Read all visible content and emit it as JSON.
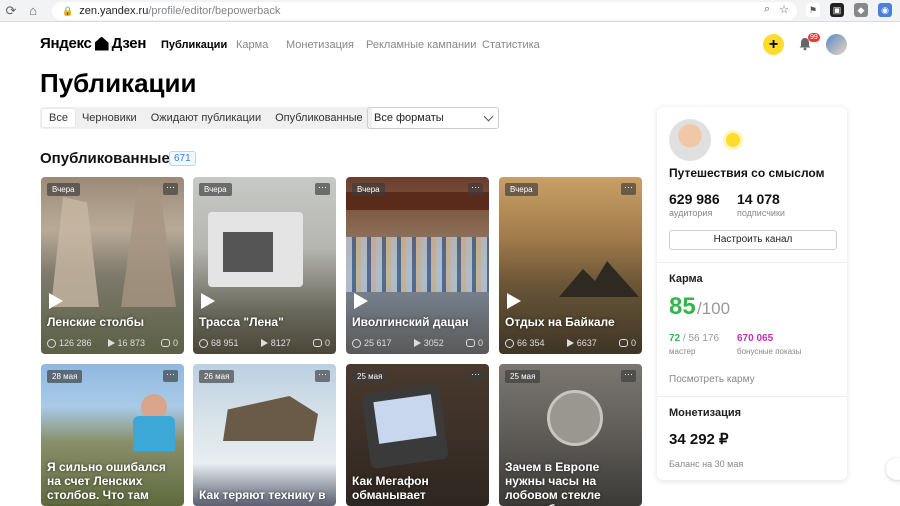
{
  "browser": {
    "url_host": "zen.yandex.ru",
    "url_path": "/profile/editor/bepowerback"
  },
  "nav": {
    "logo": "Яндекс",
    "logo_product": "Дзен",
    "items": [
      {
        "label": "Публикации",
        "active": true
      },
      {
        "label": "Карма",
        "active": false
      },
      {
        "label": "Монетизация",
        "active": false
      },
      {
        "label": "Рекламные кампании",
        "active": false
      },
      {
        "label": "Статистика",
        "active": false
      }
    ],
    "plus": "+",
    "notifications_count": "99"
  },
  "page": {
    "title": "Публикации"
  },
  "filters": {
    "tabs": [
      "Все",
      "Черновики",
      "Ожидают публикации",
      "Опубликованные"
    ],
    "active_tab": "Все",
    "format_select": "Все форматы"
  },
  "section": {
    "title": "Опубликованные",
    "count": "671"
  },
  "cards": [
    {
      "badge": "Вчера",
      "title": "Ленские столбы",
      "views": "126 286",
      "plays": "16 873",
      "comments": "0"
    },
    {
      "badge": "Вчера",
      "title": "Трасса \"Лена\"",
      "views": "68 951",
      "plays": "8127",
      "comments": "0"
    },
    {
      "badge": "Вчера",
      "title": "Иволгинский дацан",
      "views": "25 617",
      "plays": "3052",
      "comments": "0"
    },
    {
      "badge": "Вчера",
      "title": "Отдых на Байкале",
      "views": "66 354",
      "plays": "6637",
      "comments": "0"
    },
    {
      "badge": "28 мая",
      "title": "Я сильно ошибался на счет Ленских столбов. Что там посмотреть и"
    },
    {
      "badge": "26 мая",
      "title": "Как теряют технику в"
    },
    {
      "badge": "25 мая",
      "title": "Как Мегафон обманывает"
    },
    {
      "badge": "25 мая",
      "title": "Зачем в Европе нужны часы на лобовом стекле автомобиля."
    }
  ],
  "colors": {
    "accent_yellow": "#ffdc2e",
    "karma_green": "#33b64a",
    "link_blue": "#3b7de0",
    "bonus_pink": "#c230b5"
  },
  "channel": {
    "name": "Путешествия со смыслом",
    "audience": "629 986",
    "audience_label": "аудитория",
    "subscribers": "14 078",
    "subscribers_label": "подписчики",
    "settings_button": "Настроить канал"
  },
  "karma": {
    "heading": "Карма",
    "value": "85",
    "max": "/100",
    "master_value": "72",
    "master_total": " / 56 176",
    "master_label": "мастер",
    "bonus_value": "670 065",
    "bonus_label": "бонусные показы",
    "link": "Посмотреть карму"
  },
  "monetization": {
    "heading": "Монетизация",
    "amount": "34 292 ₽",
    "balance_note": "Баланс на 30 мая"
  }
}
